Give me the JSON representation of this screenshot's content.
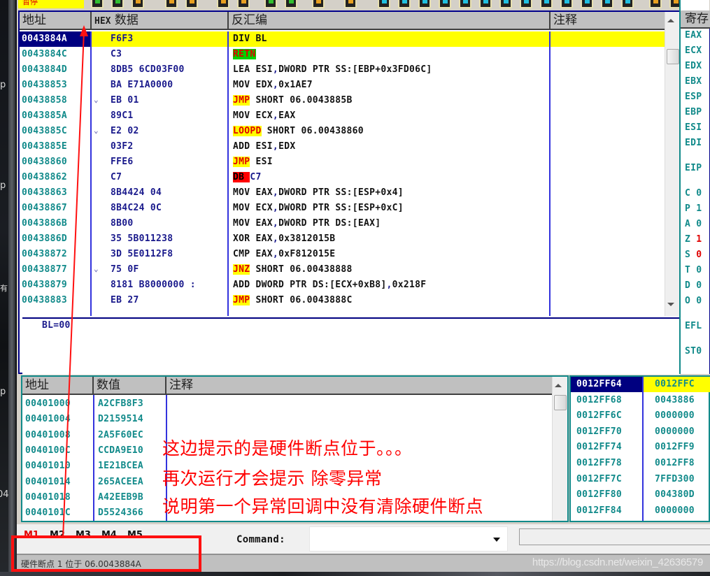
{
  "desktop": {
    "side_labels": [
      "p",
      "p",
      "有",
      "p",
      "04"
    ]
  },
  "toolbar": {
    "status_label": "暂停",
    "buttons": [
      {
        "name": "restart",
        "color": "#30c030"
      },
      {
        "name": "close",
        "color": "#30c030"
      },
      {
        "name": "stop",
        "color": "#e8a020"
      },
      {
        "name": "run",
        "color": "#e8a020"
      },
      {
        "name": "pause",
        "color": "#e8a020"
      },
      {
        "name": "step-into",
        "color": "#e8a020"
      },
      {
        "name": "step-over",
        "color": "#e8a020"
      },
      {
        "name": "trace-into",
        "color": "#30c030"
      },
      {
        "name": "trace-over",
        "color": "#30c030"
      },
      {
        "name": "execute-till-return",
        "color": "#e8a020"
      },
      {
        "name": "go-to",
        "color": "#e8a020"
      },
      {
        "name": "L",
        "color": "#20c0e0"
      },
      {
        "name": "E",
        "color": "#20c0e0"
      },
      {
        "name": "M",
        "color": "#20c0e0"
      },
      {
        "name": "T",
        "color": "#20c0e0"
      },
      {
        "name": "W",
        "color": "#20c0e0"
      },
      {
        "name": "H",
        "color": "#20c0e0"
      },
      {
        "name": "C",
        "color": "#20c0e0"
      },
      {
        "name": "slash",
        "color": "#20c0e0"
      },
      {
        "name": "K",
        "color": "#20c0e0"
      },
      {
        "name": "B",
        "color": "#20c0e0"
      },
      {
        "name": "R",
        "color": "#20c0e0"
      },
      {
        "name": "dots",
        "color": "#20c0e0"
      },
      {
        "name": "S",
        "color": "#20c0e0"
      },
      {
        "name": "list",
        "color": "#e8a020"
      },
      {
        "name": "grid",
        "color": "#e8a020"
      },
      {
        "name": "help",
        "color": "#30c030"
      }
    ]
  },
  "cpu": {
    "headers": {
      "address": "地址",
      "hex_prefix": "HEX",
      "hex": "数据",
      "disasm": "反汇编",
      "comment": "注释",
      "registers": "寄存"
    },
    "rows": [
      {
        "address": "0043884A",
        "hex": "F6F3",
        "mnemonic": "DIV",
        "operands": "BL",
        "selected": true,
        "mn_style": "plain"
      },
      {
        "address": "0043884C",
        "hex": "C3",
        "mnemonic": "RETN",
        "operands": "",
        "mn_style": "ret"
      },
      {
        "address": "0043884D",
        "hex": "8DB5 6CD03F00",
        "mnemonic": "LEA",
        "operands": "ESI,DWORD PTR SS:[EBP+0x3FD06C]",
        "mn_style": "plain"
      },
      {
        "address": "00438853",
        "hex": "BA E71A0000",
        "mnemonic": "MOV",
        "operands": "EDX,0x1AE7",
        "mn_style": "plain"
      },
      {
        "address": "00438858",
        "hex": "EB 01",
        "mnemonic": "JMP",
        "operands": "SHORT 06.0043885B",
        "mn_style": "jump",
        "jump_mark": "⌄"
      },
      {
        "address": "0043885A",
        "hex": "89C1",
        "mnemonic": "MOV",
        "operands": "ECX,EAX",
        "mn_style": "plain"
      },
      {
        "address": "0043885C",
        "hex": "E2 02",
        "mnemonic": "LOOPD",
        "operands": "SHORT 06.00438860",
        "mn_style": "jump",
        "jump_mark": "⌄"
      },
      {
        "address": "0043885E",
        "hex": "03F2",
        "mnemonic": "ADD",
        "operands": "ESI,EDX",
        "mn_style": "plain"
      },
      {
        "address": "00438860",
        "hex": "FFE6",
        "mnemonic": "JMP",
        "operands": "ESI",
        "mn_style": "jump"
      },
      {
        "address": "00438862",
        "hex": "C7",
        "mnemonic": "DB",
        "operands": "C7",
        "mn_style": "db"
      },
      {
        "address": "00438863",
        "hex": "8B4424 04",
        "mnemonic": "MOV",
        "operands": "EAX,DWORD PTR SS:[ESP+0x4]",
        "mn_style": "plain"
      },
      {
        "address": "00438867",
        "hex": "8B4C24 0C",
        "mnemonic": "MOV",
        "operands": "ECX,DWORD PTR SS:[ESP+0xC]",
        "mn_style": "plain"
      },
      {
        "address": "0043886B",
        "hex": "8B00",
        "mnemonic": "MOV",
        "operands": "EAX,DWORD PTR DS:[EAX]",
        "mn_style": "plain"
      },
      {
        "address": "0043886D",
        "hex": "35 5B011238",
        "mnemonic": "XOR",
        "operands": "EAX,0x3812015B",
        "mn_style": "plain"
      },
      {
        "address": "00438872",
        "hex": "3D 5E0112F8",
        "mnemonic": "CMP",
        "operands": "EAX,0xF812015E",
        "mn_style": "plain"
      },
      {
        "address": "00438877",
        "hex": "75 0F",
        "mnemonic": "JNZ",
        "operands": "SHORT 06.00438888",
        "mn_style": "jump",
        "jump_mark": "⌄"
      },
      {
        "address": "00438879",
        "hex": "8181 B8000000 :",
        "mnemonic": "ADD",
        "operands": "DWORD PTR DS:[ECX+0xB8],0x218F",
        "mn_style": "plain"
      },
      {
        "address": "00438883",
        "hex": "EB 27",
        "mnemonic": "JMP",
        "operands": "SHORT 06.0043888C",
        "mn_style": "jump"
      }
    ],
    "info_text": "BL=00",
    "registers": [
      "EAX",
      "ECX",
      "EDX",
      "EBX",
      "ESP",
      "EBP",
      "ESI",
      "EDI",
      "",
      "EIP",
      "",
      "C 0",
      "P 1",
      "A 0",
      "Z 1",
      "S 0",
      "T 0",
      "D 0",
      "O 0",
      "",
      "EFL",
      "",
      "ST0"
    ],
    "flag_highlight": {
      "Z 1": "#e00000",
      "S 0": "#e00000"
    }
  },
  "dump": {
    "headers": {
      "address": "地址",
      "value": "数值",
      "comment": "注释"
    },
    "rows": [
      {
        "address": "00401000",
        "value": "A2CFB8F3"
      },
      {
        "address": "00401004",
        "value": "D2159514"
      },
      {
        "address": "00401008",
        "value": "2A5F60EC"
      },
      {
        "address": "0040100C",
        "value": "CCDA9E10"
      },
      {
        "address": "00401010",
        "value": "1E21BCEA"
      },
      {
        "address": "00401014",
        "value": "265ACEEA"
      },
      {
        "address": "00401018",
        "value": "A42EEB9B"
      },
      {
        "address": "0040101C",
        "value": "D5524366"
      }
    ]
  },
  "stack": {
    "rows": [
      {
        "address": "0012FF64",
        "value": "0012FFC",
        "selected": true
      },
      {
        "address": "0012FF68",
        "value": "0043886"
      },
      {
        "address": "0012FF6C",
        "value": "0000000"
      },
      {
        "address": "0012FF70",
        "value": "0000000"
      },
      {
        "address": "0012FF74",
        "value": "0012FF9"
      },
      {
        "address": "0012FF78",
        "value": "0012FF8"
      },
      {
        "address": "0012FF7C",
        "value": "7FFD300"
      },
      {
        "address": "0012FF80",
        "value": "004380D"
      },
      {
        "address": "0012FF84",
        "value": "0000000"
      }
    ]
  },
  "command_bar": {
    "memory_tabs": [
      "M1",
      "M2",
      "M3",
      "M4",
      "M5"
    ],
    "active_tab": "M1",
    "command_label": "Command:",
    "command_value": ""
  },
  "status_bar": {
    "text": "硬件断点 1 位于 06.0043884A",
    "watermark": "https://blog.csdn.net/weixin_42636579"
  },
  "annotation": {
    "lines": [
      "这边提示的是硬件断点位于。。。",
      "再次运行才会提示 除零异常",
      "说明第一个异常回调中没有清除硬件断点"
    ],
    "color": "#ff0000"
  }
}
